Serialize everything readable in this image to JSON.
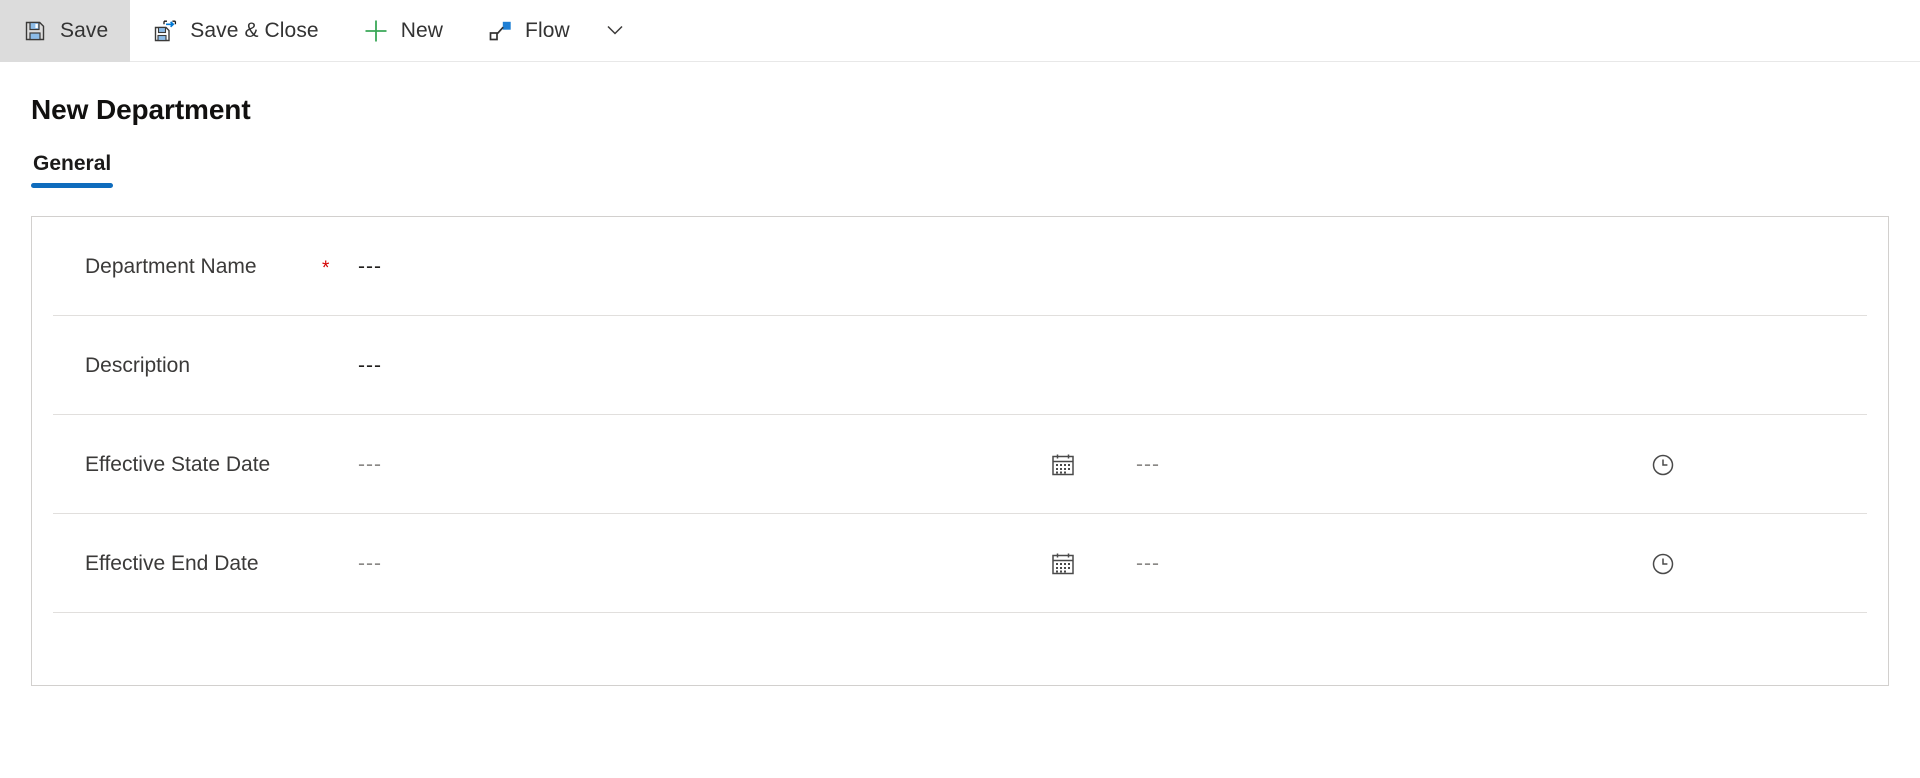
{
  "commandbar": {
    "items": [
      {
        "label": "Save",
        "icon": "save-icon",
        "active": true
      },
      {
        "label": "Save & Close",
        "icon": "save-and-close-icon",
        "active": false
      },
      {
        "label": "New",
        "icon": "add-icon",
        "active": false
      },
      {
        "label": "Flow",
        "icon": "flow-icon",
        "active": false
      }
    ],
    "overflow_caret": "chevron-down-icon"
  },
  "page": {
    "title": "New Department"
  },
  "tabs": [
    {
      "label": "General",
      "selected": true
    }
  ],
  "form": {
    "rows": [
      {
        "label": "Department Name",
        "required": "*",
        "value": "---",
        "has_date": false,
        "has_time": false
      },
      {
        "label": "Description",
        "required": "",
        "value": "---",
        "has_date": false,
        "has_time": false
      },
      {
        "label": "Effective State Date",
        "required": "",
        "value": "---",
        "has_date": true,
        "date_icon": "calendar-icon",
        "time_value": "---",
        "has_time": true,
        "time_icon": "clock-icon"
      },
      {
        "label": "Effective End Date",
        "required": "",
        "value": "---",
        "has_date": true,
        "date_icon": "calendar-icon",
        "time_value": "---",
        "has_time": true,
        "time_icon": "clock-icon"
      }
    ]
  },
  "colors": {
    "accent": "#0f6cbd",
    "icon_blue": "#0078d4",
    "icon_blue_light": "#6ba7e0",
    "required_red": "#d40000",
    "add_green": "#3aa757",
    "command_active_bg": "#dcdcdc",
    "card_border": "#d2d0ce",
    "divider": "#e1dfdd",
    "label_text": "#3b3a39",
    "title_text": "#11100f"
  }
}
